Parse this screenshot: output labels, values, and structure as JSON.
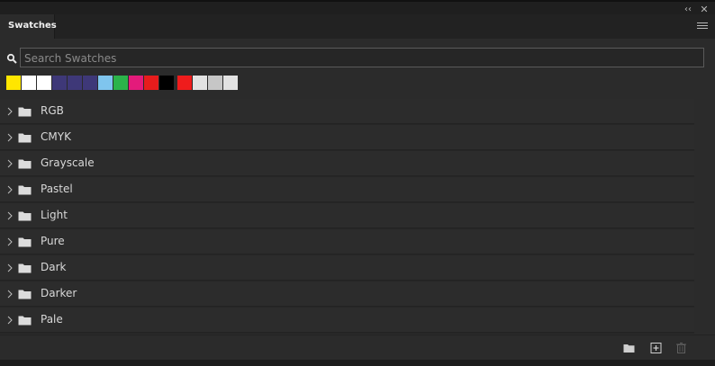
{
  "panel": {
    "tab_label": "Swatches",
    "search_placeholder": "Search Swatches"
  },
  "icons": {
    "collapse": "double-chevron-left-icon",
    "close": "close-icon",
    "menu": "hamburger-menu-icon",
    "search": "search-icon",
    "expand": "chevron-right-icon",
    "folder": "folder-icon",
    "new_group": "new-folder-icon",
    "new_swatch": "new-swatch-icon",
    "delete": "trash-icon"
  },
  "recent_swatches": [
    "#ffe600",
    "#ffffff",
    "#ffffff",
    "#3e3878",
    "#3e3878",
    "#3e3878",
    "#7fc5ee",
    "#2bb34a",
    "#e31b7b",
    "#e71c1c",
    "#000000",
    "#ef1c1c",
    "#e2e2e2",
    "#c6c6c6",
    "#e2e2e2"
  ],
  "groups": [
    {
      "label": "RGB"
    },
    {
      "label": "CMYK"
    },
    {
      "label": "Grayscale"
    },
    {
      "label": "Pastel"
    },
    {
      "label": "Light"
    },
    {
      "label": "Pure"
    },
    {
      "label": "Dark"
    },
    {
      "label": "Darker"
    },
    {
      "label": "Pale"
    }
  ]
}
